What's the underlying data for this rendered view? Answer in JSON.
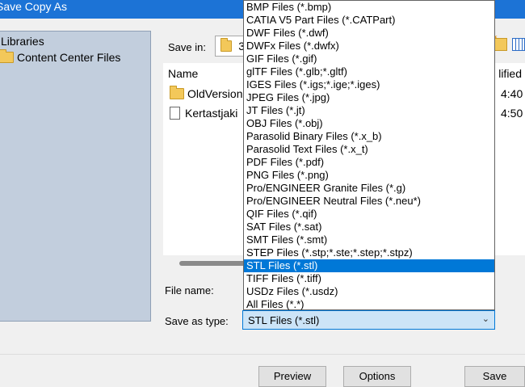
{
  "window": {
    "title": "Save Copy As"
  },
  "sidebar": {
    "title": "Libraries",
    "items": [
      {
        "label": "Content Center Files",
        "icon": "folder-icon"
      }
    ]
  },
  "save_in": {
    "label": "Save in:",
    "value_visible": "3"
  },
  "file_list": {
    "columns": {
      "name": "Name",
      "modified": "lified"
    },
    "rows": [
      {
        "name": "OldVersion",
        "date": "4:40",
        "icon": "folder-icon"
      },
      {
        "name": "Kertastjaki",
        "date": "4:50",
        "icon": "document-icon"
      }
    ]
  },
  "file_name": {
    "label": "File name:",
    "value": ""
  },
  "save_as_type": {
    "label": "Save as type:",
    "selected": "STL Files (*.stl)",
    "options": [
      "BMP Files (*.bmp)",
      "CATIA V5 Part Files (*.CATPart)",
      "DWF Files (*.dwf)",
      "DWFx Files (*.dwfx)",
      "GIF Files (*.gif)",
      "glTF Files (*.glb;*.gltf)",
      "IGES Files (*.igs;*.ige;*.iges)",
      "JPEG Files (*.jpg)",
      "JT Files (*.jt)",
      "OBJ Files (*.obj)",
      "Parasolid Binary Files (*.x_b)",
      "Parasolid Text Files (*.x_t)",
      "PDF Files (*.pdf)",
      "PNG Files (*.png)",
      "Pro/ENGINEER Granite Files (*.g)",
      "Pro/ENGINEER Neutral Files (*.neu*)",
      "QIF Files (*.qif)",
      "SAT Files (*.sat)",
      "SMT Files (*.smt)",
      "STEP Files (*.stp;*.ste;*.step;*.stpz)",
      "STL Files (*.stl)",
      "TIFF Files (*.tiff)",
      "USDz Files (*.usdz)",
      "All Files (*.*)"
    ],
    "highlighted_index": 20
  },
  "buttons": {
    "preview": "Preview",
    "options": "Options",
    "save": "Save"
  },
  "colors": {
    "accent": "#0078d7",
    "titlebar": "#1c73d6",
    "sidebar": "#c2cedd"
  }
}
